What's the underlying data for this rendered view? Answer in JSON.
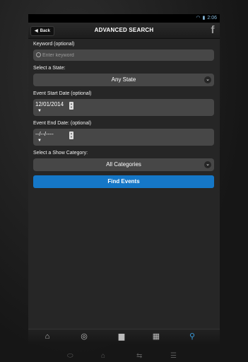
{
  "statusbar": {
    "time": "2:06",
    "wifi_icon": "wifi-icon",
    "battery_icon": "battery-icon"
  },
  "header": {
    "back_label": "Back",
    "title": "ADVANCED SEARCH",
    "fb_icon": "facebook-icon"
  },
  "form": {
    "keyword_label": "Keyword (optional)",
    "keyword_placeholder": "Enter keyword",
    "state_label": "Select a State:",
    "state_value": "Any State",
    "start_label": "Event Start Date (optional)",
    "start_value": "12/01/2014",
    "end_label": "Event End Date: (optional)",
    "end_value": "--/--/----",
    "category_label": "Select a Show Category:",
    "category_value": "All Categories",
    "submit_label": "Find Events"
  },
  "tabs": [
    "home-icon",
    "compass-icon",
    "usa-map-icon",
    "grid-icon",
    "search-icon"
  ],
  "colors": {
    "accent": "#1577c7",
    "field": "#474747",
    "screen": "#262626"
  }
}
